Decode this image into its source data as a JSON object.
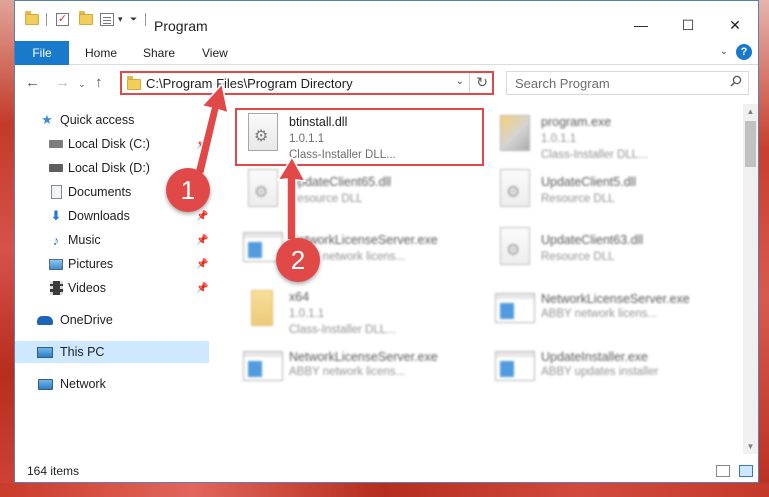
{
  "window": {
    "title": "Program",
    "controls": {
      "minimize": "—",
      "maximize": "☐",
      "close": "✕"
    }
  },
  "ribbon": {
    "tabs": [
      {
        "label": "File"
      },
      {
        "label": "Home"
      },
      {
        "label": "Share"
      },
      {
        "label": "View"
      }
    ],
    "help": "?"
  },
  "address_bar": {
    "path": "C:\\Program Files\\Program Directory",
    "search_placeholder": "Search Program"
  },
  "nav_pane": {
    "items": [
      {
        "label": "Quick access",
        "icon": "star-icon",
        "pinned": false
      },
      {
        "label": "Local Disk (C:)",
        "icon": "drive-icon",
        "pinned": true
      },
      {
        "label": "Local Disk (D:)",
        "icon": "drive-icon",
        "pinned": false
      },
      {
        "label": "Documents",
        "icon": "documents-icon",
        "pinned": true
      },
      {
        "label": "Downloads",
        "icon": "download-arrow-icon",
        "pinned": true
      },
      {
        "label": "Music",
        "icon": "music-note-icon",
        "pinned": true
      },
      {
        "label": "Pictures",
        "icon": "pictures-icon",
        "pinned": true
      },
      {
        "label": "Videos",
        "icon": "video-icon",
        "pinned": true
      },
      {
        "label": "OneDrive",
        "icon": "cloud-icon",
        "pinned": false
      },
      {
        "label": "This PC",
        "icon": "computer-icon",
        "pinned": false,
        "selected": true
      },
      {
        "label": "Network",
        "icon": "network-icon",
        "pinned": false
      }
    ]
  },
  "files": [
    {
      "name": "btinstall.dll",
      "version": "1.0.1.1",
      "description": "Class-Installer DLL...",
      "type": "dll",
      "highlighted": true
    },
    {
      "name": "program.exe",
      "version": "1.0.1.1",
      "description": "Class-Installer DLL...",
      "type": "program",
      "highlighted": false
    },
    {
      "name": "UpdateClient65.dll",
      "version": "",
      "description": "Resource DLL",
      "type": "dll",
      "highlighted": false
    },
    {
      "name": "UpdateClient5.dll",
      "version": "",
      "description": "Resource DLL",
      "type": "dll",
      "highlighted": false
    },
    {
      "name": "NetworkLicenseServer.exe",
      "version": "",
      "description": "ABBY network licens...",
      "type": "exe",
      "highlighted": false
    },
    {
      "name": "UpdateClient63.dll",
      "version": "",
      "description": "Resource DLL",
      "type": "dll",
      "highlighted": false
    },
    {
      "name": "x64",
      "version": "1.0.1.1",
      "description": "Class-Installer DLL...",
      "type": "folder",
      "highlighted": false
    },
    {
      "name": "NetworkLicenseServer.exe",
      "version": "",
      "description": "ABBY network licens...",
      "type": "exe",
      "highlighted": false
    },
    {
      "name": "NetworkLicenseServer.exe",
      "version": "",
      "description": "ABBY network licens...",
      "type": "exe",
      "highlighted": false
    },
    {
      "name": "UpdateInstaller.exe",
      "version": "",
      "description": "ABBY updates installer",
      "type": "exe",
      "highlighted": false
    }
  ],
  "status_bar": {
    "item_count": "164 items"
  },
  "annotations": [
    {
      "number": "1",
      "target": "address-bar"
    },
    {
      "number": "2",
      "target": "btinstall.dll"
    }
  ],
  "colors": {
    "accent": "#1979ca",
    "annotation": "#e14848",
    "selection": "#cde8ff"
  }
}
